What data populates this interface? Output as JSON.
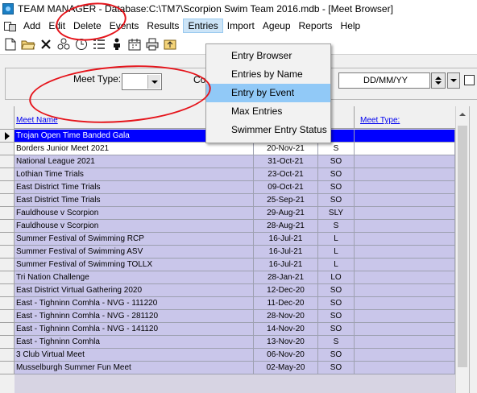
{
  "window": {
    "title": "TEAM MANAGER - Database:C:\\TM7\\Scorpion Swim Team 2016.mdb - [Meet Browser]"
  },
  "menubar": {
    "items": [
      {
        "label": "Add"
      },
      {
        "label": "Edit"
      },
      {
        "label": "Delete"
      },
      {
        "label": "Events"
      },
      {
        "label": "Results"
      },
      {
        "label": "Entries",
        "active": true
      },
      {
        "label": "Import"
      },
      {
        "label": "Ageup"
      },
      {
        "label": "Reports"
      },
      {
        "label": "Help"
      }
    ]
  },
  "toolbar": {
    "icons": [
      "new-document-icon",
      "open-folder-icon",
      "delete-x-icon",
      "team-icon",
      "clock-icon",
      "list-icon",
      "swimmer-icon",
      "calendar-icon",
      "print-icon",
      "export-icon"
    ]
  },
  "entries_menu": {
    "items": [
      {
        "label": "Entry Browser"
      },
      {
        "label": "Entries by Name"
      },
      {
        "label": "Entry by Event",
        "highlighted": true
      },
      {
        "label": "Max Entries"
      },
      {
        "label": "Swimmer Entry Status"
      }
    ]
  },
  "filter": {
    "meet_type_label": "Meet Type:",
    "meet_type_value": "",
    "partial_label": "Co",
    "date_placeholder": "DD/MM/YY"
  },
  "grid": {
    "headers": {
      "meet_name": "Meet Name",
      "meet_type": "Meet Type:"
    },
    "rows": [
      {
        "name": "Trojan Open Time Banded Gala",
        "date": "",
        "type": "",
        "selected": true
      },
      {
        "name": "Borders Junior Meet 2021",
        "date": "20-Nov-21",
        "type": "S"
      },
      {
        "name": "National League 2021",
        "date": "31-Oct-21",
        "type": "SO"
      },
      {
        "name": "Lothian Time Trials",
        "date": "23-Oct-21",
        "type": "SO"
      },
      {
        "name": "East District Time Trials",
        "date": "09-Oct-21",
        "type": "SO"
      },
      {
        "name": "East District Time Trials",
        "date": "25-Sep-21",
        "type": "SO"
      },
      {
        "name": "Fauldhouse v Scorpion",
        "date": "29-Aug-21",
        "type": "SLY"
      },
      {
        "name": "Fauldhouse v Scorpion",
        "date": "28-Aug-21",
        "type": "S"
      },
      {
        "name": "Summer Festival of Swimming RCP",
        "date": "16-Jul-21",
        "type": "L"
      },
      {
        "name": "Summer Festival of Swimming ASV",
        "date": "16-Jul-21",
        "type": "L"
      },
      {
        "name": "Summer Festival of Swimming TOLLX",
        "date": "16-Jul-21",
        "type": "L"
      },
      {
        "name": "Tri Nation Challenge",
        "date": "28-Jan-21",
        "type": "LO"
      },
      {
        "name": "East District Virtual Gathering 2020",
        "date": "12-Dec-20",
        "type": "SO"
      },
      {
        "name": "East - Tighninn Comhla - NVG - 111220",
        "date": "11-Dec-20",
        "type": "SO"
      },
      {
        "name": "East - Tighninn Comhla - NVG - 281120",
        "date": "28-Nov-20",
        "type": "SO"
      },
      {
        "name": "East - Tighninn Comhla - NVG - 141120",
        "date": "14-Nov-20",
        "type": "SO"
      },
      {
        "name": "East - Tighninn Comhla",
        "date": "13-Nov-20",
        "type": "S"
      },
      {
        "name": "3 Club Virtual Meet",
        "date": "06-Nov-20",
        "type": "SO"
      },
      {
        "name": "Musselburgh Summer Fun Meet",
        "date": "02-May-20",
        "type": "SO"
      }
    ]
  },
  "colors": {
    "selected_row": "#0000ff",
    "row_bg": "#c9c6ea",
    "menu_highlight": "#91c9f7",
    "annotation": "#e5141b"
  }
}
